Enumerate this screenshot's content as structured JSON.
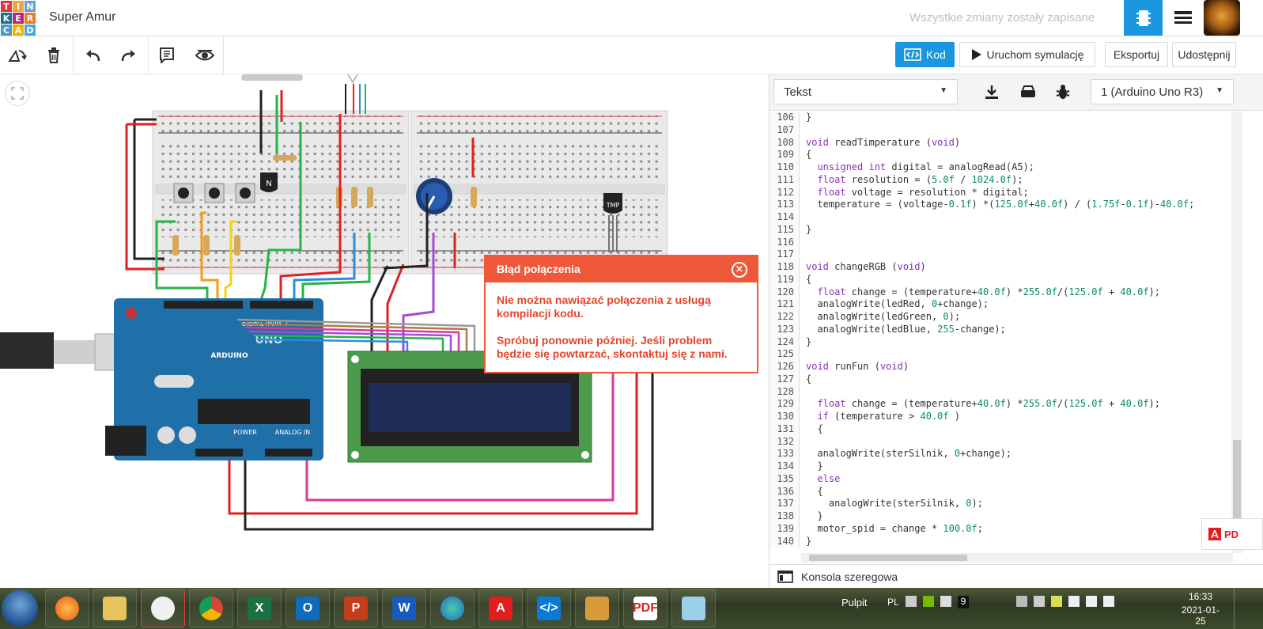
{
  "app": {
    "logo_letters": [
      "T",
      "I",
      "N",
      "K",
      "E",
      "R",
      "C",
      "A",
      "D"
    ],
    "logo_colors": [
      "#e6323e",
      "#f2a33a",
      "#6a9fd7",
      "#1e6f8f",
      "#b02a7b",
      "#e87b24",
      "#4d97c9",
      "#f0b400",
      "#47aad9"
    ],
    "project_title": "Super Amur",
    "save_status": "Wszystkie zmiany zostały zapisane"
  },
  "toolbar": {
    "icons": [
      "rotate-icon",
      "trash-icon",
      "undo-icon",
      "redo-icon",
      "notes-icon",
      "visibility-icon"
    ],
    "code_label": "Kod",
    "simulate_label": "Uruchom symulację",
    "export_label": "Eksportuj",
    "share_label": "Udostępnij"
  },
  "canvas": {
    "arduino_brand": "ARDUINO",
    "arduino_model": "UNO",
    "digital_label": "DIGITAL (PWM~)",
    "power_label": "POWER",
    "analog_label": "ANALOG IN",
    "transistor_label": "N",
    "sensor_label": "TMP"
  },
  "error_dialog": {
    "title": "Błąd połączenia",
    "message1": "Nie można nawiązać połączenia z usługą kompilacji kodu.",
    "message2": "Spróbuj ponownie później. Jeśli problem będzie się powtarzać, skontaktuj się z nami."
  },
  "code_panel": {
    "mode_select": "Tekst",
    "device_select": "1 (Arduino Uno R3)",
    "console_label": "Konsola szeregowa",
    "lines": [
      {
        "n": "106",
        "t": "}"
      },
      {
        "n": "107",
        "t": ""
      },
      {
        "n": "108",
        "t": "void readTimperature (void)"
      },
      {
        "n": "109",
        "t": "{"
      },
      {
        "n": "110",
        "t": "  unsigned int digital = analogRead(A5);"
      },
      {
        "n": "111",
        "t": "  float resolution = (5.0f / 1024.0f);"
      },
      {
        "n": "112",
        "t": "  float voltage = resolution * digital;"
      },
      {
        "n": "113",
        "t": "  temperature = (voltage-0.1f) *(125.0f+40.0f) / (1.75f-0.1f)-40.0f;"
      },
      {
        "n": "114",
        "t": ""
      },
      {
        "n": "115",
        "t": "}"
      },
      {
        "n": "116",
        "t": ""
      },
      {
        "n": "117",
        "t": ""
      },
      {
        "n": "118",
        "t": "void changeRGB (void)"
      },
      {
        "n": "119",
        "t": "{"
      },
      {
        "n": "120",
        "t": "  float change = (temperature+40.0f) *255.0f/(125.0f + 40.0f);"
      },
      {
        "n": "121",
        "t": "  analogWrite(ledRed, 0+change);"
      },
      {
        "n": "122",
        "t": "  analogWrite(ledGreen, 0);"
      },
      {
        "n": "123",
        "t": "  analogWrite(ledBlue, 255-change);"
      },
      {
        "n": "124",
        "t": "}"
      },
      {
        "n": "125",
        "t": ""
      },
      {
        "n": "126",
        "t": "void runFun (void)"
      },
      {
        "n": "127",
        "t": "{"
      },
      {
        "n": "128",
        "t": ""
      },
      {
        "n": "129",
        "t": "  float change = (temperature+40.0f) *255.0f/(125.0f + 40.0f);"
      },
      {
        "n": "130",
        "t": "  if (temperature > 40.0f )"
      },
      {
        "n": "131",
        "t": "  {"
      },
      {
        "n": "132",
        "t": ""
      },
      {
        "n": "133",
        "t": "  analogWrite(sterSilnik, 0+change);"
      },
      {
        "n": "134",
        "t": "  }"
      },
      {
        "n": "135",
        "t": "  else"
      },
      {
        "n": "136",
        "t": "  {"
      },
      {
        "n": "137",
        "t": "    analogWrite(sterSilnik, 0);"
      },
      {
        "n": "138",
        "t": "  }"
      },
      {
        "n": "139",
        "t": "  motor_spid = change * 100.0f;"
      },
      {
        "n": "140",
        "t": "}"
      }
    ]
  },
  "pdf_ad": {
    "label": "PD"
  },
  "taskbar": {
    "apps": [
      "firefox",
      "file-explorer",
      "snipping-tool",
      "chrome",
      "excel",
      "outlook",
      "powerpoint",
      "word",
      "edge",
      "acrobat",
      "vscode",
      "app-tool",
      "pdf-reader",
      "notes"
    ],
    "desktop_label": "Pulpit",
    "language": "PL",
    "tray_number": "9",
    "time": "16:33",
    "date": "2021-01-25"
  }
}
